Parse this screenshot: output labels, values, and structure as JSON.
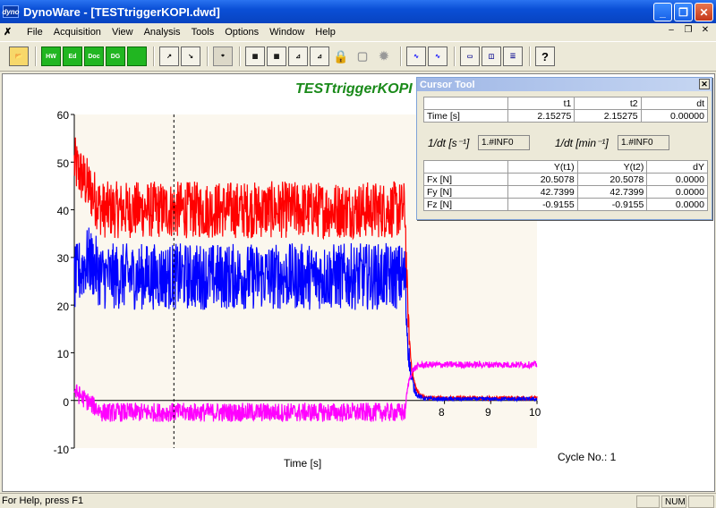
{
  "app": {
    "icon_label": "dyno",
    "title": "DynoWare - [TESTtriggerKOPI.dwd]"
  },
  "menu": [
    "File",
    "Acquisition",
    "View",
    "Analysis",
    "Tools",
    "Options",
    "Window",
    "Help"
  ],
  "toolbar": {
    "buttons": [
      "open-folder-icon",
      "hw-icon",
      "ed-icon",
      "doc-icon",
      "dg-icon",
      "green-square-icon",
      "axes-icon-1",
      "axes-icon-2",
      "cursor-select-icon",
      "grid-icon-1",
      "grid-icon-2",
      "grid-icon-3",
      "grid-icon-4",
      "lock-icon",
      "unlock-icon",
      "gear-icon",
      "wave-icon-1",
      "wave-icon-2",
      "window-icon-1",
      "window-icon-2",
      "window-icon-3",
      "help-icon"
    ],
    "labels": {
      "hw": "HW",
      "ed": "Ed",
      "doc": "Doc",
      "dg": "DG"
    }
  },
  "chart_data": {
    "type": "line",
    "title": "TESTtriggerKOPI",
    "xlabel": "Time [s]",
    "xlim": [
      0,
      10
    ],
    "ylim": [
      -10,
      60
    ],
    "yticks": [
      "60",
      "50",
      "40",
      "30",
      "20",
      "10",
      "0",
      "-10"
    ],
    "xticks_visible": [
      "8",
      "9",
      "10"
    ],
    "cursor_x": 2.15275,
    "series": [
      {
        "name": "Fx [N]",
        "color": "#ff0000",
        "pre_trigger_center": 40,
        "pre_trigger_amplitude": 6,
        "initial_peak": 52,
        "post_trigger_center": 0.5,
        "trigger_time": 7.15
      },
      {
        "name": "Fy [N]",
        "color": "#0000ff",
        "pre_trigger_center": 26,
        "pre_trigger_amplitude": 7,
        "initial_peak": 35,
        "post_trigger_center": 0.3,
        "trigger_time": 7.15
      },
      {
        "name": "Fz [N]",
        "color": "#ff00ff",
        "pre_trigger_center": -2.5,
        "pre_trigger_amplitude": 2.0,
        "initial_peak": 3,
        "post_trigger_center": 7.5,
        "trigger_time": 7.15
      }
    ]
  },
  "cycle": "Cycle No.: 1",
  "cursor_tool": {
    "title": "Cursor Tool",
    "time_header": [
      "",
      "t1",
      "t2",
      "dt"
    ],
    "time_row": [
      "Time [s]",
      "2.15275",
      "2.15275",
      "0.00000"
    ],
    "inv_sec_label": "1/dt [s⁻¹]",
    "inv_sec_value": "1.#INF0",
    "inv_min_label": "1/dt [min⁻¹]",
    "inv_min_value": "1.#INF0",
    "y_header": [
      "",
      "Y(t1)",
      "Y(t2)",
      "dY"
    ],
    "y_rows": [
      [
        "Fx [N]",
        "20.5078",
        "20.5078",
        "0.0000"
      ],
      [
        "Fy [N]",
        "42.7399",
        "42.7399",
        "0.0000"
      ],
      [
        "Fz [N]",
        "-0.9155",
        "-0.9155",
        "0.0000"
      ]
    ]
  },
  "status": {
    "help": "For Help, press F1",
    "num": "NUM"
  }
}
